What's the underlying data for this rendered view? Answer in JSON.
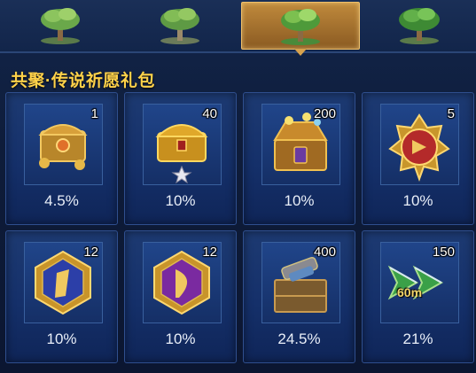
{
  "tabs": [
    {
      "icon": "tree-icon",
      "active": false
    },
    {
      "icon": "tree-icon",
      "active": false
    },
    {
      "icon": "tree-icon",
      "active": true
    },
    {
      "icon": "tree-icon",
      "active": false
    }
  ],
  "section_title": "共聚·传说祈愿礼包",
  "items": [
    {
      "icon": "small-chest-icon",
      "qty": "1",
      "pct": "4.5%"
    },
    {
      "icon": "gold-chest-icon",
      "qty": "40",
      "pct": "10%"
    },
    {
      "icon": "treasure-chest-icon",
      "qty": "200",
      "pct": "10%"
    },
    {
      "icon": "red-medal-icon",
      "qty": "5",
      "pct": "10%"
    },
    {
      "icon": "blue-emblem-icon",
      "qty": "12",
      "pct": "10%"
    },
    {
      "icon": "purple-emblem-icon",
      "qty": "12",
      "pct": "10%"
    },
    {
      "icon": "supply-crate-icon",
      "qty": "400",
      "pct": "24.5%"
    },
    {
      "icon": "speedup-arrow-icon",
      "qty": "150",
      "pct": "21%",
      "overlay": "60m"
    }
  ]
}
